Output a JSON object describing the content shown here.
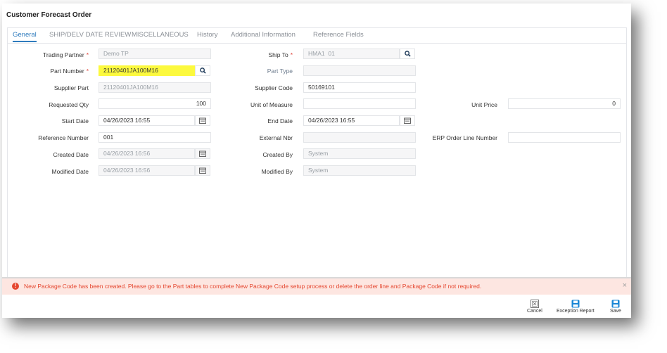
{
  "window": {
    "title": "Customer Forecast Order"
  },
  "tabs": [
    {
      "label": "General",
      "active": true
    },
    {
      "label": "SHIP/DELV DATE REVIEW",
      "active": false
    },
    {
      "label": "MISCELLANEOUS",
      "active": false
    },
    {
      "label": "History",
      "active": false
    },
    {
      "label": "Additional Information",
      "active": false
    },
    {
      "label": "Reference Fields",
      "active": false
    }
  ],
  "form": {
    "trading_partner": {
      "label": "Trading Partner",
      "required_mark": "*",
      "value": "Demo TP"
    },
    "part_number": {
      "label": "Part Number",
      "required_mark": "*",
      "value": "21120401JA100M16"
    },
    "supplier_part": {
      "label": "Supplier Part",
      "value": "21120401JA100M16"
    },
    "requested_qty": {
      "label": "Requested Qty",
      "value": "100"
    },
    "start_date": {
      "label": "Start Date",
      "value": "04/26/2023 16:55"
    },
    "reference_number": {
      "label": "Reference Number",
      "value": "001"
    },
    "created_date": {
      "label": "Created Date",
      "value": "04/26/2023 16:56"
    },
    "modified_date": {
      "label": "Modified Date",
      "value": "04/26/2023 16:56"
    },
    "ship_to": {
      "label": "Ship To",
      "required_mark": "*",
      "value": "HMA1  01"
    },
    "part_type": {
      "label": "Part Type",
      "value": ""
    },
    "supplier_code": {
      "label": "Supplier Code",
      "value": "50169101"
    },
    "unit_of_measure": {
      "label": "Unit of Measure",
      "value": ""
    },
    "end_date": {
      "label": "End Date",
      "value": "04/26/2023 16:55"
    },
    "external_nbr": {
      "label": "External Nbr",
      "value": ""
    },
    "created_by": {
      "label": "Created By",
      "value": "System"
    },
    "modified_by": {
      "label": "Modified By",
      "value": "System"
    },
    "unit_price": {
      "label": "Unit Price",
      "value": "0"
    },
    "erp_order_line_number": {
      "label": "ERP Order Line Number",
      "value": ""
    }
  },
  "alert": {
    "type": "error",
    "message": "New Package Code has been created. Please go to the Part tables to complete New Package Code setup process or delete the order line and Package Code if not required.",
    "close_label": "×"
  },
  "toolbar": {
    "cancel_label": "Cancel",
    "exception_report_label": "Exception Report",
    "save_label": "Save"
  },
  "colors": {
    "accent": "#2f7bbd",
    "error": "#e5462f",
    "error_bg": "#fde6e1",
    "highlight": "#fcf93e"
  }
}
